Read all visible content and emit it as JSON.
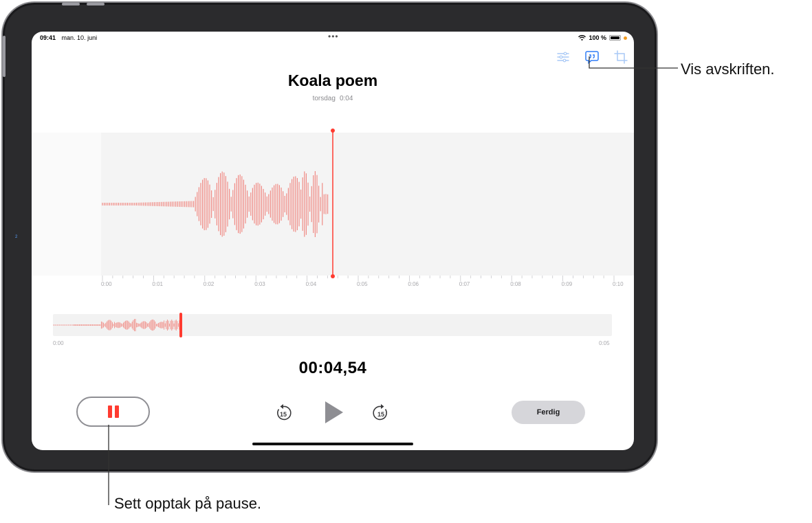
{
  "status_bar": {
    "time": "09:41",
    "date": "man. 10. juni",
    "center_dots": "•••",
    "battery": "100 %"
  },
  "toolbar": {
    "icons": [
      "options-icon",
      "transcript-icon",
      "trim-icon"
    ]
  },
  "recording": {
    "title": "Koala poem",
    "day": "torsdag",
    "duration": "0:04"
  },
  "timeline_ticks": [
    "0:00",
    "0:01",
    "0:02",
    "0:03",
    "0:04",
    "0:05",
    "0:06",
    "0:07",
    "0:08",
    "0:09",
    "0:10"
  ],
  "overview": {
    "start_label": "0:00",
    "end_label": "0:05"
  },
  "elapsed_time": "00:04,54",
  "controls": {
    "skip_back_label": "15",
    "skip_forward_label": "15",
    "done_label": "Ferdig"
  },
  "side_marker": "2",
  "callouts": {
    "transcript": "Vis avskriften.",
    "pause": "Sett opptak på pause."
  },
  "colors": {
    "accent_red": "#ff3b30",
    "waveform_red": "#f08a84",
    "tint_blue": "#2f7cf6",
    "tint_blue_light": "#a9c9f5"
  }
}
